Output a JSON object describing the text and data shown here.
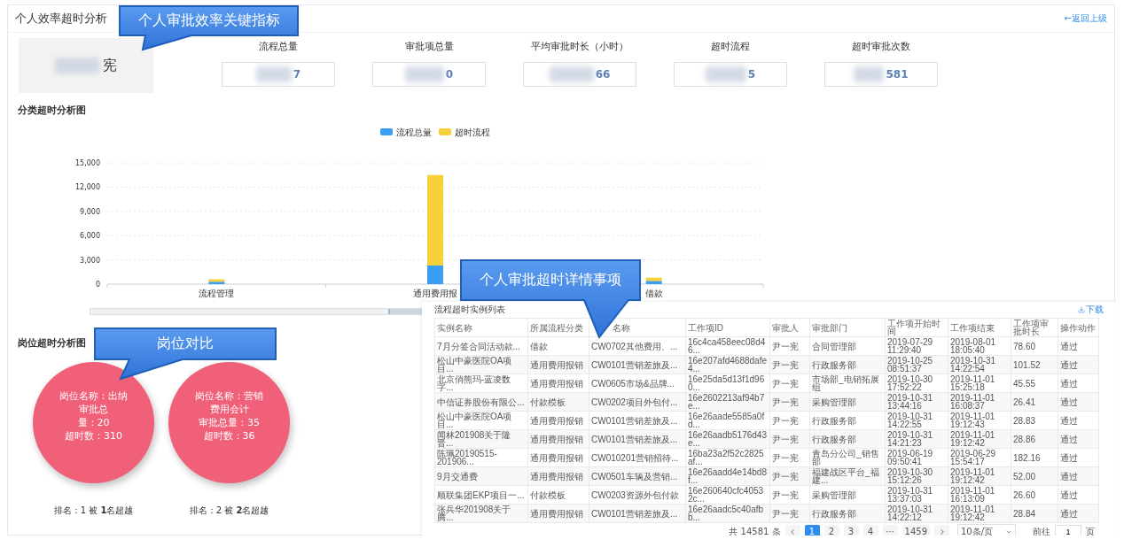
{
  "header": {
    "title": "个人效率超时分析",
    "back_link": "←返回上级"
  },
  "profile": {
    "name": "宪"
  },
  "kpis": [
    {
      "label": "流程总量",
      "value": "7"
    },
    {
      "label": "审批项总量",
      "value": "0"
    },
    {
      "label": "平均审批时长（小时）",
      "value": "66"
    },
    {
      "label": "超时流程",
      "value": "5"
    },
    {
      "label": "超时审批次数",
      "value": "581"
    }
  ],
  "category_chart": {
    "title": "分类超时分析图",
    "chart_data": {
      "type": "bar",
      "stacked": true,
      "categories": [
        "流程管理",
        "通用费用报",
        "借款"
      ],
      "series": [
        {
          "name": "流程总量",
          "color": "#3a9ff2",
          "values": [
            300,
            2300,
            400
          ]
        },
        {
          "name": "超时流程",
          "color": "#f8d13a",
          "values": [
            300,
            11200,
            400
          ]
        }
      ],
      "ylim": [
        0,
        15000
      ],
      "grid": true,
      "legend": true,
      "yticks": [
        {
          "value": 0,
          "label": "0"
        },
        {
          "value": 3000,
          "label": "3,000"
        },
        {
          "value": 6000,
          "label": "6,000"
        },
        {
          "value": 9000,
          "label": "9,000"
        },
        {
          "value": 12000,
          "label": "12,000"
        },
        {
          "value": 15000,
          "label": "15,000"
        }
      ]
    }
  },
  "zoom_slider": {
    "level": 0.9
  },
  "position_section": {
    "title": "岗位超时分析图",
    "positions": [
      {
        "lines": [
          "岗位名称：出纳",
          "审批总",
          "量：20",
          "超时数：310"
        ],
        "rank": "排名：1 被 **1**名超越"
      },
      {
        "lines": [
          "岗位名称：营销",
          "费用会计",
          "审批总量：35",
          "超时数：36"
        ],
        "rank": "排名：2 被 **2**名超越"
      }
    ]
  },
  "instance_table": {
    "title": "流程超时实例列表",
    "download": "下载",
    "columns": [
      "实例名称",
      "所属流程分类",
      "名称",
      "工作项ID",
      "审批人",
      "审批部门",
      "工作项开始时间",
      "工作项结束",
      "工作项审批时长",
      "操作动作"
    ],
    "rows": [
      [
        "7月分签合同活动款...",
        "借款",
        "CW0702其他费用、...",
        "16c4ca458eec08d46...",
        "尹一宪",
        "合同管理部",
        "2019-07-29 11:29:40",
        "2019-08-01 18:05:40",
        "78.60",
        "通过"
      ],
      [
        "松山中豪医院OA项目...",
        "通用费用报销",
        "CW0101营销差旅及...",
        "16e207afd4688dafe4...",
        "尹一宪",
        "行政服务部",
        "2019-10-25 08:51:37",
        "2019-10-31 14:22:54",
        "101.52",
        "通过"
      ],
      [
        "北京俏熊玛-蓝凌数字...",
        "通用费用报销",
        "CW0605市场&品牌...",
        "16e25da5d13f1d960...",
        "尹一宪",
        "市场部_电销拓展组",
        "2019-10-30 17:52:22",
        "2019-11-01 15:25:18",
        "45.55",
        "通过"
      ],
      [
        "中信证券股份有限公...",
        "付款模板",
        "CW0202项目外包付...",
        "16e2602213af94b7e...",
        "尹一宪",
        "采购管理部",
        "2019-10-31 13:44:16",
        "2019-11-01 16:08:37",
        "26.41",
        "通过"
      ],
      [
        "松山中豪医院OA项目...",
        "通用费用报销",
        "CW0101营销差旅及...",
        "16e26aade5585a0fd...",
        "尹一宪",
        "行政服务部",
        "2019-10-31 14:22:55",
        "2019-11-01 19:12:43",
        "28.83",
        "通过"
      ],
      [
        "闻林201908关于隆晋...",
        "通用费用报销",
        "CW0101营销差旅及...",
        "16e26aadb5176d43e...",
        "尹一宪",
        "行政服务部",
        "2019-10-31 14:21:23",
        "2019-11-01 19:12:42",
        "28.86",
        "通过"
      ],
      [
        "陈珮20190515-201906...",
        "通用费用报销",
        "CW010201营销招待...",
        "16ba23a2f52c2825af...",
        "尹一宪",
        "青岛分公司_销售部",
        "2019-06-19 09:50:41",
        "2019-06-29 15:54:17",
        "182.16",
        "通过"
      ],
      [
        "9月交通费",
        "通用费用报销",
        "CW0501车辆及营销...",
        "16e26aadd4e14bd8f...",
        "尹一宪",
        "福建战区平台_福建...",
        "2019-10-30 15:12:26",
        "2019-11-01 19:12:42",
        "52.00",
        "通过"
      ],
      [
        "顺联集团EKP项目一...",
        "付款模板",
        "CW0203资源外包付款",
        "16e260640cfc40532c...",
        "尹一宪",
        "采购管理部",
        "2019-10-31 13:37:03",
        "2019-11-01 16:13:09",
        "26.60",
        "通过"
      ],
      [
        "张兵华201908关于腾...",
        "通用费用报销",
        "CW0101营销差旅及...",
        "16e26aadc5c40afbb...",
        "尹一宪",
        "行政服务部",
        "2019-10-31 14:22:12",
        "2019-11-01 19:12:42",
        "28.84",
        "通过"
      ]
    ],
    "pagination": {
      "total": "共 14581 条",
      "pages": [
        {
          "label": "1",
          "selected": true
        },
        {
          "label": "2",
          "selected": false
        },
        {
          "label": "3",
          "selected": false
        },
        {
          "label": "4",
          "selected": false
        },
        {
          "label": "···",
          "selected": false
        },
        {
          "label": "1459",
          "selected": false
        }
      ],
      "page_size": "10条/页",
      "goto_label": "前往",
      "goto_value": "1",
      "goto_suffix": "页"
    }
  },
  "callouts": [
    {
      "text": "个人审批效率关键指标"
    },
    {
      "text": "个人审批超时详情事项"
    },
    {
      "text": "岗位对比"
    }
  ]
}
